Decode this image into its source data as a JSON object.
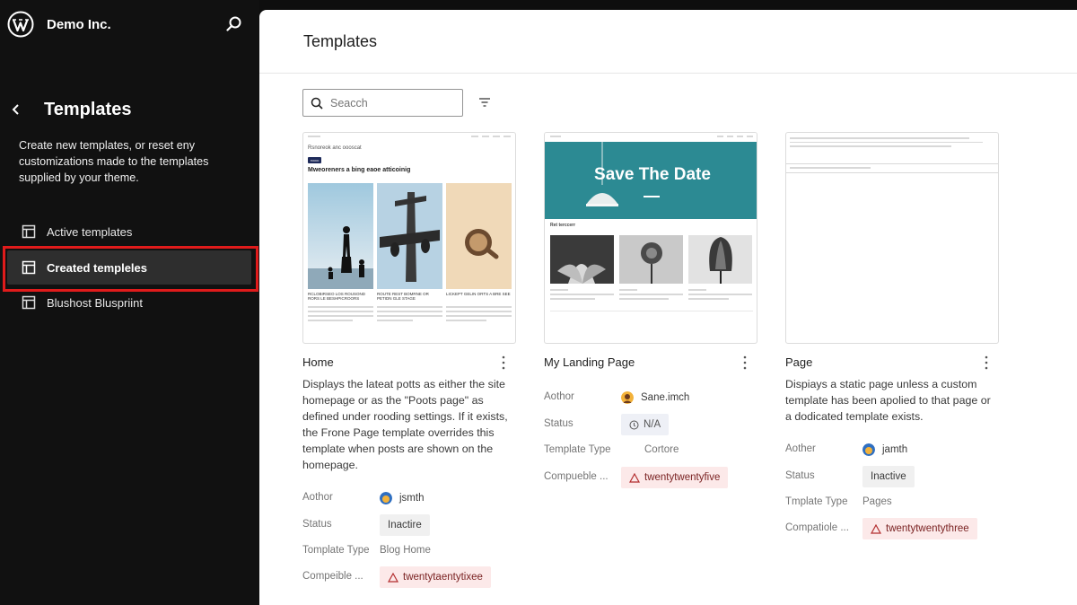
{
  "sidebar": {
    "site_name": "Demo Inc.",
    "title": "Templates",
    "description": "Create new templates, or reset eny customizations made to the templates supplied by your theme.",
    "nav": [
      {
        "label": "Active templates"
      },
      {
        "label": "Created templeles"
      },
      {
        "label": "Blushost Bluspriint"
      }
    ]
  },
  "main": {
    "title": "Templates",
    "search": {
      "placeholder": "Seacch"
    }
  },
  "cards": [
    {
      "title": "Home",
      "description": "Displays the lateat potts as either the site homepage or as the \"Poots page\" as defined under rooding settings. If it exists, the Frone Page template overrides this template when posts are shown on the homepage.",
      "author_label": "Aothor",
      "author": "jsmth",
      "status_label": "Status",
      "status": "Inactire",
      "type_label": "Tomplate Type",
      "type": "Blog Home",
      "compat_label": "Compeible ...",
      "compat": "twentytaentytixee",
      "preview": {
        "header": "Rsnoreok anc oooscat",
        "badge": "rcccc",
        "headline": "Mweoreners a bing eaoe atticoinig",
        "captions": [
          "RCLOBIRSEO LOS ROUSOND RORS LE BESHPICROORS",
          "ROUTE REST BOMRNE OR PETIDN GLE STAGE",
          "LICKEPT GELIN ORTS A BRE SEE"
        ]
      }
    },
    {
      "title": "My Landing Page",
      "author_label": "Aothor",
      "author": "Sane.imch",
      "status_label": "Status",
      "status": "N/A",
      "type_label": "Template Type",
      "type": "Cortore",
      "compat_label": "Compueble ...",
      "compat": "twentytwentyfive",
      "preview": {
        "hero_text": "Save The Date",
        "section": "Ret terccerr"
      }
    },
    {
      "title": "Page",
      "description": "Dispiays a static page unless a custom template has been apolied to that page or a dodicated template exists.",
      "author_label": "Aother",
      "author": "jamth",
      "status_label": "Status",
      "status": "Inactive",
      "type_label": "Tmplate Type",
      "type": "Pages",
      "compat_label": "Compatiole ...",
      "compat": "twentytwentythree"
    }
  ],
  "colors": {
    "sidebar_bg": "#111111",
    "highlight": "#e01b1b",
    "hero_teal": "#2c8a93",
    "warning_bg": "#fce9e9"
  }
}
